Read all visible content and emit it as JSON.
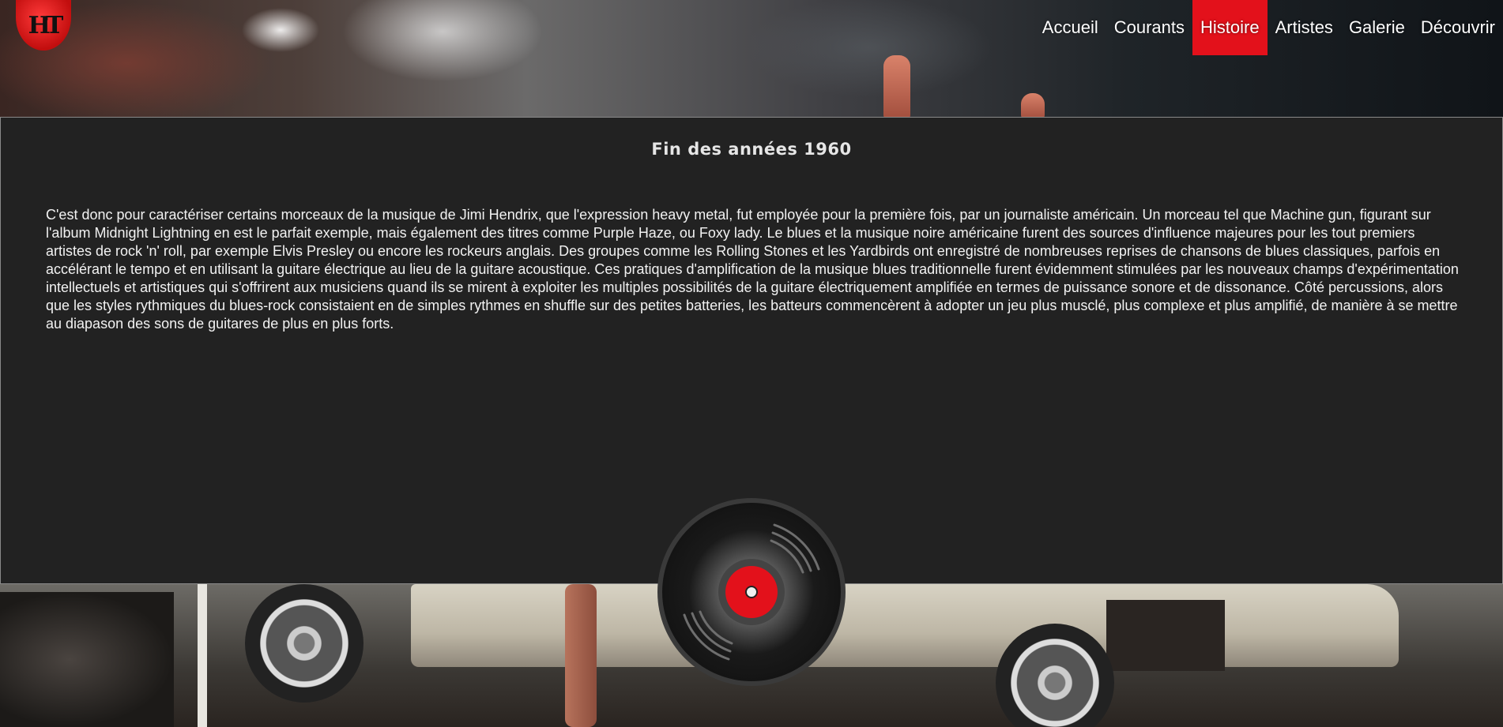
{
  "logo": {
    "text": "HT"
  },
  "nav": {
    "items": [
      {
        "label": "Accueil",
        "active": false
      },
      {
        "label": "Courants",
        "active": false
      },
      {
        "label": "Histoire",
        "active": true
      },
      {
        "label": "Artistes",
        "active": false
      },
      {
        "label": "Galerie",
        "active": false
      },
      {
        "label": "Découvrir",
        "active": false
      }
    ]
  },
  "article": {
    "title": "Fin des années 1960",
    "body": "C'est donc pour caractériser certains morceaux de la musique de Jimi Hendrix, que l'expression heavy metal, fut employée pour la première fois, par un journaliste américain. Un morceau tel que Machine gun, figurant sur l'album Midnight Lightning en est le parfait exemple, mais également des titres comme Purple Haze, ou Foxy lady. Le blues et la musique noire américaine furent des sources d'influence majeures pour les tout premiers artistes de rock 'n' roll, par exemple Elvis Presley ou encore les rockeurs anglais. Des groupes comme les Rolling Stones et les Yardbirds ont enregistré de nombreuses reprises de chansons de blues classiques, parfois en accélérant le tempo et en utilisant la guitare électrique au lieu de la guitare acoustique. Ces pratiques d'amplification de la musique blues traditionnelle furent évidemment stimulées par les nouveaux champs d'expérimentation intellectuels et artistiques qui s'offrirent aux musiciens quand ils se mirent à exploiter les multiples possibilités de la guitare électriquement amplifiée en termes de puissance sonore et de dissonance. Côté percussions, alors que les styles rythmiques du blues-rock consistaient en de simples rythmes en shuffle sur des petites batteries, les batteurs commencèrent à adopter un jeu plus musclé, plus complexe et plus amplifié, de manière à se mettre au diapason des sons de guitares de plus en plus forts."
  },
  "icons": {
    "record": "vinyl-record-icon",
    "logo": "guitar-pick-logo"
  },
  "colors": {
    "accent": "#e3111b",
    "panel": "#222222",
    "text": "#f2f2f2"
  }
}
